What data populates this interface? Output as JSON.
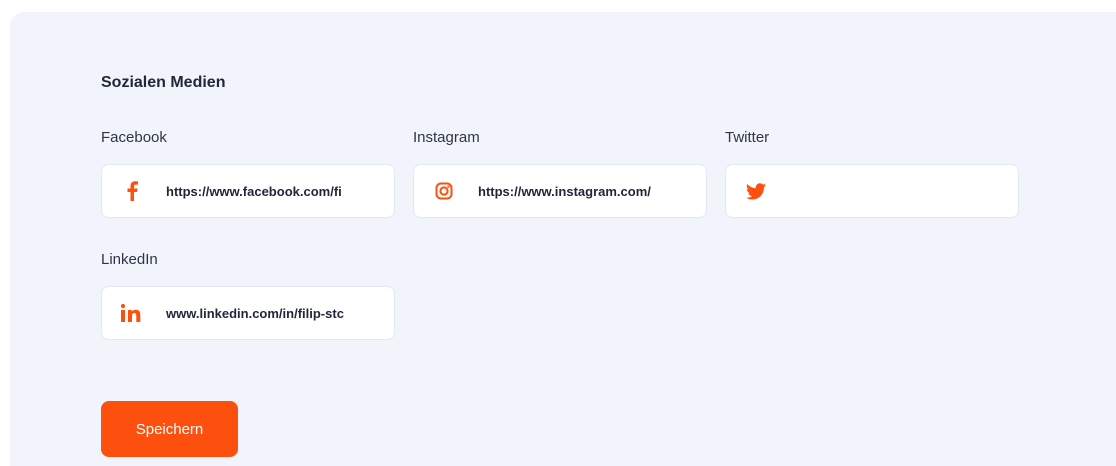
{
  "section": {
    "title": "Sozialen Medien"
  },
  "fields": {
    "facebook": {
      "label": "Facebook",
      "value": "https://www.facebook.com/fi",
      "icon": "facebook-icon"
    },
    "instagram": {
      "label": "Instagram",
      "value": "https://www.instagram.com/",
      "icon": "instagram-icon"
    },
    "twitter": {
      "label": "Twitter",
      "value": "",
      "icon": "twitter-icon"
    },
    "linkedin": {
      "label": "LinkedIn",
      "value": "www.linkedin.com/in/filip-stc",
      "icon": "linkedin-icon"
    }
  },
  "actions": {
    "save_label": "Speichern"
  },
  "colors": {
    "accent": "#fd4f0e",
    "panel_background": "#f1f4fb",
    "input_background": "#ffffff"
  }
}
